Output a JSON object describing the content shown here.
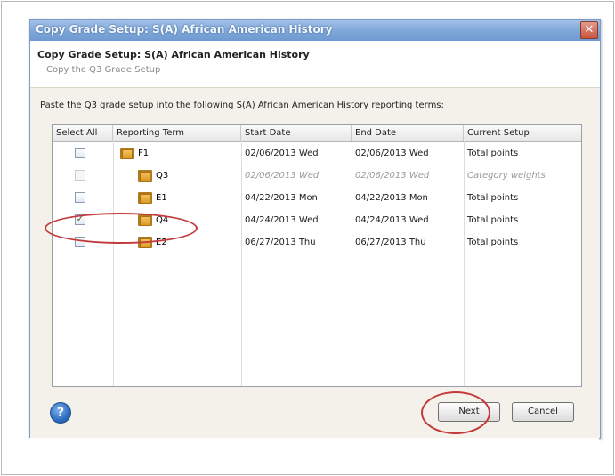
{
  "window": {
    "title": "Copy Grade Setup: S(A) African American History",
    "close_glyph": "✕"
  },
  "header": {
    "title": "Copy Grade Setup: S(A) African American History",
    "subtitle": "Copy the Q3 Grade Setup"
  },
  "instruction": "Paste the Q3 grade setup into the following S(A) African American History reporting terms:",
  "grid": {
    "columns": [
      "Select All",
      "Reporting Term",
      "Start Date",
      "End Date",
      "Current Setup"
    ],
    "rows": [
      {
        "checked": false,
        "disabled": false,
        "term": "F1",
        "start": "02/06/2013 Wed",
        "end": "02/06/2013 Wed",
        "setup": "Total points"
      },
      {
        "checked": false,
        "disabled": true,
        "term": "Q3",
        "start": "02/06/2013 Wed",
        "end": "02/06/2013 Wed",
        "setup": "Category weights"
      },
      {
        "checked": false,
        "disabled": false,
        "term": "E1",
        "start": "04/22/2013 Mon",
        "end": "04/22/2013 Mon",
        "setup": "Total points"
      },
      {
        "checked": true,
        "disabled": false,
        "term": "Q4",
        "start": "04/24/2013 Wed",
        "end": "04/24/2013 Wed",
        "setup": "Total points"
      },
      {
        "checked": false,
        "disabled": false,
        "term": "E2",
        "start": "06/27/2013 Thu",
        "end": "06/27/2013 Thu",
        "setup": "Total points"
      }
    ]
  },
  "footer": {
    "help_glyph": "?",
    "next_label": "Next",
    "cancel_label": "Cancel"
  },
  "colors": {
    "annotation": "#c23a3a",
    "titlebar": "#7ea6d8"
  }
}
